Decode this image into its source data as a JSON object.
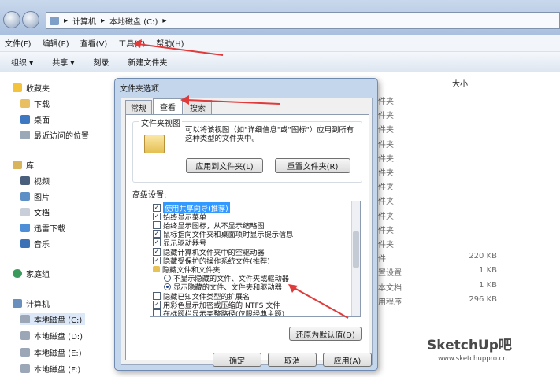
{
  "address": {
    "crumbs": [
      "计算机",
      "本地磁盘 (C:)"
    ]
  },
  "menu": [
    "文件(F)",
    "编辑(E)",
    "查看(V)",
    "工具(T)",
    "帮助(H)"
  ],
  "toolbar": {
    "organize": "组织 ▾",
    "share": "共享 ▾",
    "burn": "刻录",
    "new_folder": "新建文件夹"
  },
  "nav": {
    "favorites": "收藏夹",
    "fav_items": [
      "下载",
      "桌面",
      "最近访问的位置"
    ],
    "libraries": "库",
    "lib_items": [
      "视频",
      "图片",
      "文档",
      "迅雷下载",
      "音乐"
    ],
    "homegroup": "家庭组",
    "computer": "计算机",
    "drives": [
      "本地磁盘 (C:)",
      "本地磁盘 (D:)",
      "本地磁盘 (E:)",
      "本地磁盘 (F:)"
    ]
  },
  "files": {
    "size_header": "大小",
    "rows": [
      {
        "type": "件夹",
        "size": ""
      },
      {
        "type": "件夹",
        "size": ""
      },
      {
        "type": "件夹",
        "size": ""
      },
      {
        "type": "件夹",
        "size": ""
      },
      {
        "type": "件夹",
        "size": ""
      },
      {
        "type": "件夹",
        "size": ""
      },
      {
        "type": "件夹",
        "size": ""
      },
      {
        "type": "件夹",
        "size": ""
      },
      {
        "type": "件夹",
        "size": ""
      },
      {
        "type": "件夹",
        "size": ""
      },
      {
        "type": "件夹",
        "size": ""
      },
      {
        "type": "件",
        "size": "220 KB"
      },
      {
        "type": "置设置",
        "size": "1 KB"
      },
      {
        "type": "本文档",
        "size": "1 KB"
      },
      {
        "type": "用程序",
        "size": "296 KB"
      }
    ]
  },
  "dialog": {
    "title": "文件夹选项",
    "tabs": [
      "常规",
      "查看",
      "搜索"
    ],
    "folder_view_label": "文件夹视图",
    "folder_view_desc": "可以将该视图（如\"详细信息\"或\"图标\"）应用到所有这种类型的文件夹中。",
    "apply_to_folders": "应用到文件夹(L)",
    "reset_folders": "重置文件夹(R)",
    "advanced_label": "高级设置:",
    "options": [
      {
        "kind": "cb",
        "checked": true,
        "text": "使用共享向导(推荐)",
        "indent": 0,
        "selected": true
      },
      {
        "kind": "cb",
        "checked": true,
        "text": "始终显示菜单",
        "indent": 0
      },
      {
        "kind": "cb",
        "checked": false,
        "text": "始终显示图标，从不显示缩略图",
        "indent": 0
      },
      {
        "kind": "cb",
        "checked": true,
        "text": "鼠标指向文件夹和桌面项时显示提示信息",
        "indent": 0
      },
      {
        "kind": "cb",
        "checked": true,
        "text": "显示驱动器号",
        "indent": 0
      },
      {
        "kind": "cb",
        "checked": true,
        "text": "隐藏计算机文件夹中的空驱动器",
        "indent": 0
      },
      {
        "kind": "cb",
        "checked": true,
        "text": "隐藏受保护的操作系统文件(推荐)",
        "indent": 0
      },
      {
        "kind": "folder",
        "checked": false,
        "text": "隐藏文件和文件夹",
        "indent": 0
      },
      {
        "kind": "rb",
        "checked": false,
        "text": "不显示隐藏的文件、文件夹或驱动器",
        "indent": 1
      },
      {
        "kind": "rb",
        "checked": true,
        "text": "显示隐藏的文件、文件夹和驱动器",
        "indent": 1
      },
      {
        "kind": "cb",
        "checked": false,
        "text": "隐藏已知文件类型的扩展名",
        "indent": 0
      },
      {
        "kind": "cb",
        "checked": true,
        "text": "用彩色显示加密或压缩的 NTFS 文件",
        "indent": 0
      },
      {
        "kind": "cb",
        "checked": false,
        "text": "在标题栏显示完整路径(仅限经典主题)",
        "indent": 0
      }
    ],
    "restore_defaults": "还原为默认值(D)",
    "ok": "确定",
    "cancel": "取消",
    "apply": "应用(A)"
  },
  "watermark": {
    "brand": "SketchUp吧",
    "url": "www.sketchuppro.cn"
  },
  "colors": {
    "arrow": "#e03a3a",
    "selection": "#3399ff"
  }
}
